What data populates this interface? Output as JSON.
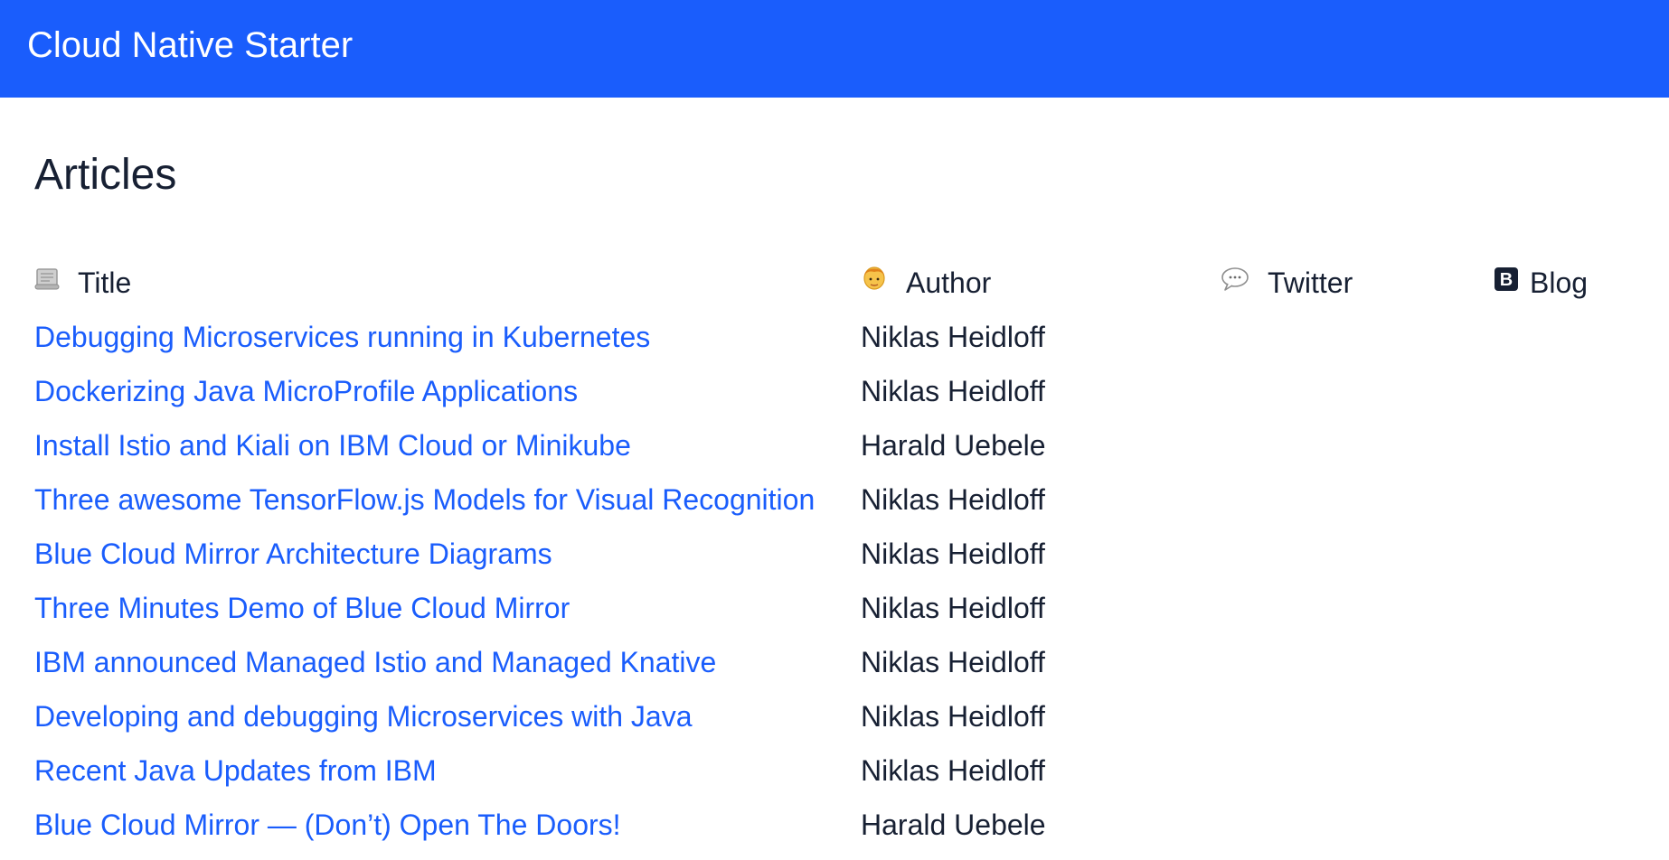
{
  "header": {
    "app_title": "Cloud Native Starter"
  },
  "page": {
    "title": "Articles"
  },
  "table": {
    "columns": {
      "title": "Title",
      "author": "Author",
      "twitter": "Twitter",
      "blog": "Blog"
    },
    "icons": {
      "title": "scroll-icon",
      "author": "person-icon",
      "twitter": "speech-bubble-icon",
      "blog": "b-square-icon"
    },
    "rows": [
      {
        "title": "Debugging Microservices running in Kubernetes",
        "author": "Niklas Heidloff"
      },
      {
        "title": "Dockerizing Java MicroProfile Applications",
        "author": "Niklas Heidloff"
      },
      {
        "title": "Install Istio and Kiali on IBM Cloud or Minikube",
        "author": "Harald Uebele"
      },
      {
        "title": "Three awesome TensorFlow.js Models for Visual Recognition",
        "author": "Niklas Heidloff"
      },
      {
        "title": "Blue Cloud Mirror Architecture Diagrams",
        "author": "Niklas Heidloff"
      },
      {
        "title": "Three Minutes Demo of Blue Cloud Mirror",
        "author": "Niklas Heidloff"
      },
      {
        "title": "IBM announced Managed Istio and Managed Knative",
        "author": "Niklas Heidloff"
      },
      {
        "title": "Developing and debugging Microservices with Java",
        "author": "Niklas Heidloff"
      },
      {
        "title": "Recent Java Updates from IBM",
        "author": "Niklas Heidloff"
      },
      {
        "title": "Blue Cloud Mirror — (Don’t) Open The Doors!",
        "author": "Harald Uebele"
      }
    ]
  },
  "colors": {
    "header_bg": "#1a5dfc",
    "link": "#1a5dfc",
    "text": "#172033"
  }
}
